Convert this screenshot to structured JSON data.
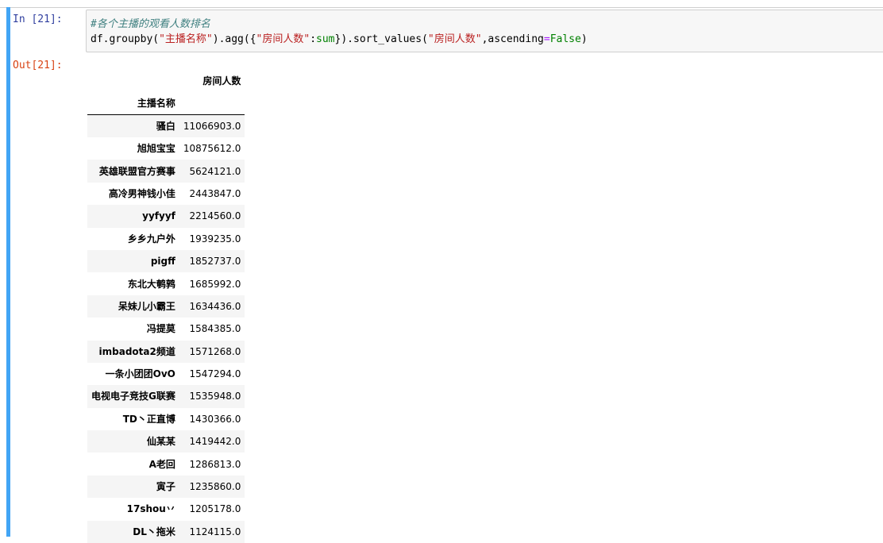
{
  "cell": {
    "in_prompt": "In [21]:",
    "out_prompt": "Out[21]:",
    "code_comment": "#各个主播的观看人数排名",
    "code_line2_parts": [
      "df.groupby(",
      "\"主播名称\"",
      ").agg({",
      "\"房间人数\"",
      ":",
      "sum",
      "}).sort_values(",
      "\"房间人数\"",
      ",ascending",
      "=",
      "False",
      ")"
    ]
  },
  "table": {
    "column_header": "房间人数",
    "index_name": "主播名称",
    "rows": [
      {
        "name": "骚白",
        "value": "11066903.0"
      },
      {
        "name": "旭旭宝宝",
        "value": "10875612.0"
      },
      {
        "name": "英雄联盟官方赛事",
        "value": "5624121.0"
      },
      {
        "name": "高冷男神钱小佳",
        "value": "2443847.0"
      },
      {
        "name": "yyfyyf",
        "value": "2214560.0"
      },
      {
        "name": "乡乡九户外",
        "value": "1939235.0"
      },
      {
        "name": "pigff",
        "value": "1852737.0"
      },
      {
        "name": "东北大鹌鹑",
        "value": "1685992.0"
      },
      {
        "name": "呆妹儿小霸王",
        "value": "1634436.0"
      },
      {
        "name": "冯提莫",
        "value": "1584385.0"
      },
      {
        "name": "imbadota2频道",
        "value": "1571268.0"
      },
      {
        "name": "一条小团团OvO",
        "value": "1547294.0"
      },
      {
        "name": "电视电子竞技G联赛",
        "value": "1535948.0"
      },
      {
        "name": "TD丶正直博",
        "value": "1430366.0"
      },
      {
        "name": "仙某某",
        "value": "1419442.0"
      },
      {
        "name": "A老回",
        "value": "1286813.0"
      },
      {
        "name": "寅子",
        "value": "1235860.0"
      },
      {
        "name": "17shou丷",
        "value": "1205178.0"
      },
      {
        "name": "DL丶拖米",
        "value": "1124115.0"
      }
    ]
  },
  "colors": {
    "cell_accent": "#42a5f5",
    "in_prompt": "#303f9f",
    "out_prompt": "#d84315",
    "string": "#ba2121",
    "comment": "#408080",
    "builtin": "#008000"
  }
}
